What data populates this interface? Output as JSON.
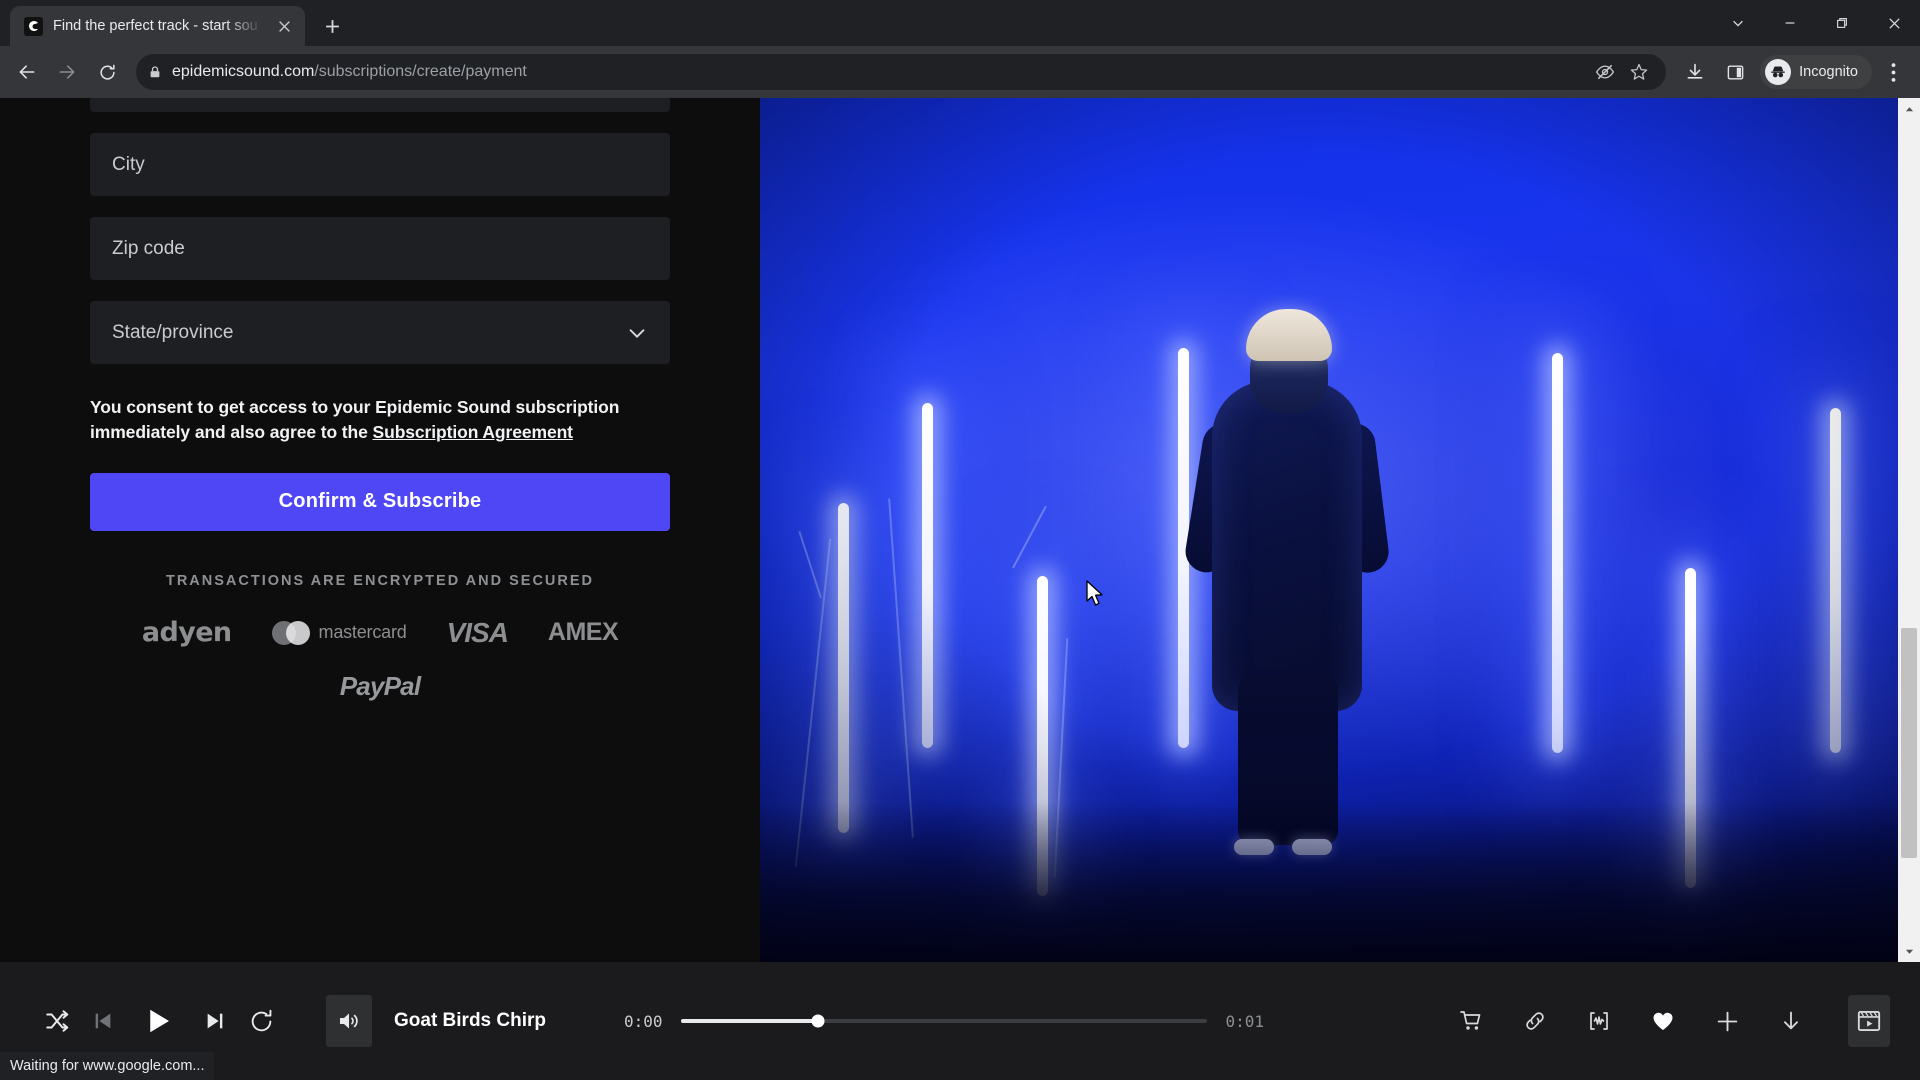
{
  "browser": {
    "tab": {
      "title": "Find the perfect track - start sou",
      "favicon_icon": "epidemic-sound-favicon",
      "close_icon": "close-icon"
    },
    "new_tab_icon": "plus-icon",
    "window_controls": {
      "tab_search_icon": "chevron-down-icon",
      "minimize_icon": "minimize-icon",
      "maximize_icon": "maximize-icon",
      "close_icon": "close-icon"
    },
    "toolbar": {
      "back_icon": "arrow-left-icon",
      "forward_icon": "arrow-right-icon",
      "reload_icon": "reload-icon",
      "lock_icon": "lock-icon",
      "url_domain": "epidemicsound.com",
      "url_path": "/subscriptions/create/payment",
      "url_full": "epidemicsound.com/subscriptions/create/payment",
      "tracking_protection_icon": "eye-slash-icon",
      "bookmark_icon": "star-icon",
      "download_icon": "download-icon",
      "side_panel_icon": "side-panel-icon",
      "profile_label": "Incognito",
      "profile_icon": "incognito-icon",
      "menu_icon": "three-dot-menu-icon"
    },
    "status_bar": {
      "text": "Waiting for www.google.com..."
    },
    "scrollbar": {
      "up_arrow_icon": "scroll-up-arrow-icon",
      "down_arrow_icon": "scroll-down-arrow-icon"
    }
  },
  "checkout": {
    "fields": [
      {
        "name": "address-field-partial",
        "placeholder": "",
        "value": "",
        "cutoff": true
      },
      {
        "name": "city-field",
        "placeholder": "City",
        "value": ""
      },
      {
        "name": "zip-code-field",
        "placeholder": "Zip code",
        "value": ""
      }
    ],
    "state_select": {
      "placeholder": "State/province",
      "value": "",
      "chevron_icon": "chevron-down-icon"
    },
    "consent": {
      "text_before": "You consent to get access to your Epidemic Sound subscription immediately and also agree to the ",
      "link_text": "Subscription Agreement"
    },
    "submit_label": "Confirm & Subscribe",
    "secured_note": "TRANSACTIONS ARE ENCRYPTED AND SECURED",
    "payment_logos": [
      {
        "name": "adyen-logo",
        "label": "adyen"
      },
      {
        "name": "mastercard-logo",
        "label": "mastercard"
      },
      {
        "name": "visa-logo",
        "label": "VISA"
      },
      {
        "name": "amex-logo",
        "label": "AMEX"
      }
    ],
    "payment_logos_row2": [
      {
        "name": "paypal-logo",
        "label": "PayPal"
      }
    ],
    "accent_color": "#4f46f5"
  },
  "media": {
    "description": "Person in white beanie and dark jacket standing among vertical blue neon light tubes on a stage"
  },
  "player": {
    "shuffle_icon": "shuffle-icon",
    "previous_icon": "skip-previous-icon",
    "play_icon": "play-icon",
    "next_icon": "skip-next-icon",
    "repeat_icon": "repeat-icon",
    "volume_icon": "volume-icon",
    "track_title": "Goat Birds Chirp",
    "time_current": "0:00",
    "time_total": "0:01",
    "progress_percent": 26,
    "actions": [
      {
        "name": "cart-icon",
        "label": "cart-icon"
      },
      {
        "name": "link-icon",
        "label": "link-icon"
      },
      {
        "name": "waveform-icon",
        "label": "waveform-icon"
      },
      {
        "name": "heart-icon",
        "label": "heart-icon"
      },
      {
        "name": "plus-icon",
        "label": "plus-icon"
      },
      {
        "name": "download-icon",
        "label": "download-icon"
      }
    ],
    "video_toggle_icon": "video-player-icon"
  }
}
